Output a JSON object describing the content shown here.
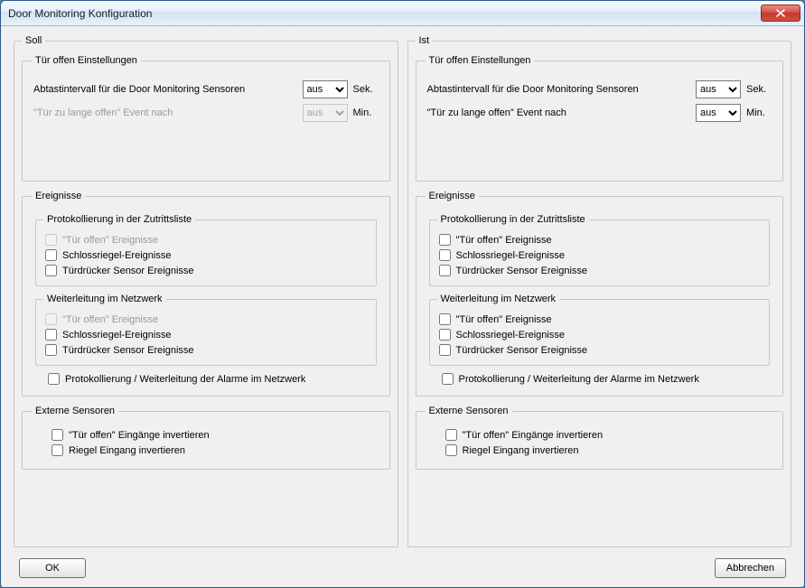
{
  "window": {
    "title": "Door Monitoring Konfiguration"
  },
  "columns": {
    "soll": {
      "legend": "Soll",
      "door_settings": {
        "legend": "Tür offen Einstellungen",
        "sampling_label": "Abtastintervall für die Door Monitoring Sensoren",
        "sampling_value": "aus",
        "sampling_unit": "Sek.",
        "too_long_label": "\"Tür zu lange offen\" Event nach",
        "too_long_value": "aus",
        "too_long_unit": "Min.",
        "too_long_disabled": true
      },
      "events": {
        "legend": "Ereignisse",
        "logging": {
          "legend": "Protokollierung in der Zutrittsliste",
          "open_label": "\"Tür offen\" Ereignisse",
          "open_disabled": true,
          "bolt_label": "Schlossriegel-Ereignisse",
          "handle_label": "Türdrücker Sensor Ereignisse"
        },
        "forwarding": {
          "legend": "Weiterleitung im Netzwerk",
          "open_label": "\"Tür offen\" Ereignisse",
          "open_disabled": true,
          "bolt_label": "Schlossriegel-Ereignisse",
          "handle_label": "Türdrücker Sensor Ereignisse"
        },
        "alarm_label": "Protokollierung / Weiterleitung der Alarme im Netzwerk"
      },
      "external": {
        "legend": "Externe Sensoren",
        "invert_open_label": "\"Tür offen\" Eingänge invertieren",
        "invert_bolt_label": "Riegel Eingang invertieren"
      }
    },
    "ist": {
      "legend": "Ist",
      "door_settings": {
        "legend": "Tür offen Einstellungen",
        "sampling_label": "Abtastintervall für die Door Monitoring Sensoren",
        "sampling_value": "aus",
        "sampling_unit": "Sek.",
        "too_long_label": "\"Tür zu lange offen\" Event nach",
        "too_long_value": "aus",
        "too_long_unit": "Min.",
        "too_long_disabled": false
      },
      "events": {
        "legend": "Ereignisse",
        "logging": {
          "legend": "Protokollierung in der Zutrittsliste",
          "open_label": "\"Tür offen\" Ereignisse",
          "open_disabled": false,
          "bolt_label": "Schlossriegel-Ereignisse",
          "handle_label": "Türdrücker Sensor Ereignisse"
        },
        "forwarding": {
          "legend": "Weiterleitung im Netzwerk",
          "open_label": "\"Tür offen\" Ereignisse",
          "open_disabled": false,
          "bolt_label": "Schlossriegel-Ereignisse",
          "handle_label": "Türdrücker Sensor Ereignisse"
        },
        "alarm_label": "Protokollierung / Weiterleitung der Alarme im Netzwerk"
      },
      "external": {
        "legend": "Externe Sensoren",
        "invert_open_label": "\"Tür offen\" Eingänge invertieren",
        "invert_bolt_label": "Riegel Eingang invertieren"
      }
    }
  },
  "buttons": {
    "ok": "OK",
    "cancel": "Abbrechen"
  },
  "combo_options": [
    "aus"
  ]
}
